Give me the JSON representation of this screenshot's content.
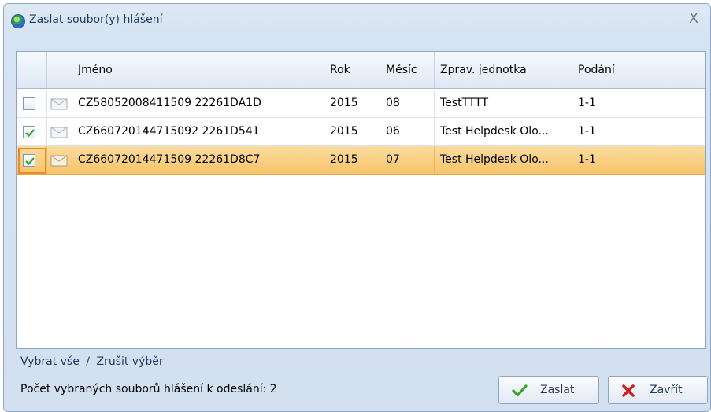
{
  "window": {
    "title": "Zaslat soubor(y) hlášení",
    "close_glyph": "X"
  },
  "grid": {
    "columns": [
      "",
      "",
      "Jméno",
      "Rok",
      "Měsíc",
      "Zprav. jednotka",
      "Podání"
    ],
    "rows": [
      {
        "checked": false,
        "name": "CZ58052008411509 22261DA1D",
        "year": "2015",
        "month": "08",
        "unit": "TestTTTT",
        "submission": "1-1",
        "selected": false
      },
      {
        "checked": true,
        "name": "CZ660720144715092 2261D541",
        "year": "2015",
        "month": "06",
        "unit": "Test Helpdesk Olo...",
        "submission": "1-1",
        "selected": false
      },
      {
        "checked": true,
        "name": "CZ66072014471509 22261D8C7",
        "year": "2015",
        "month": "07",
        "unit": "Test Helpdesk Olo...",
        "submission": "1-1",
        "selected": true
      }
    ]
  },
  "links": {
    "select_all": "Vybrat vše",
    "separator": "/",
    "deselect": "Zrušit výběr"
  },
  "status": {
    "count_text": "Počet vybraných souborů hlášení k odeslání: 2"
  },
  "buttons": {
    "send": "Zaslat",
    "close": "Zavřít"
  },
  "colors": {
    "accent_selected_row": "#f6c46a",
    "focus_border": "#f08a1e",
    "send_check": "#3aa12f",
    "close_x": "#cc2222"
  },
  "icons": {
    "title": "globe-icon",
    "row": "envelope-icon",
    "send": "checkmark-icon",
    "close": "red-x-icon"
  }
}
